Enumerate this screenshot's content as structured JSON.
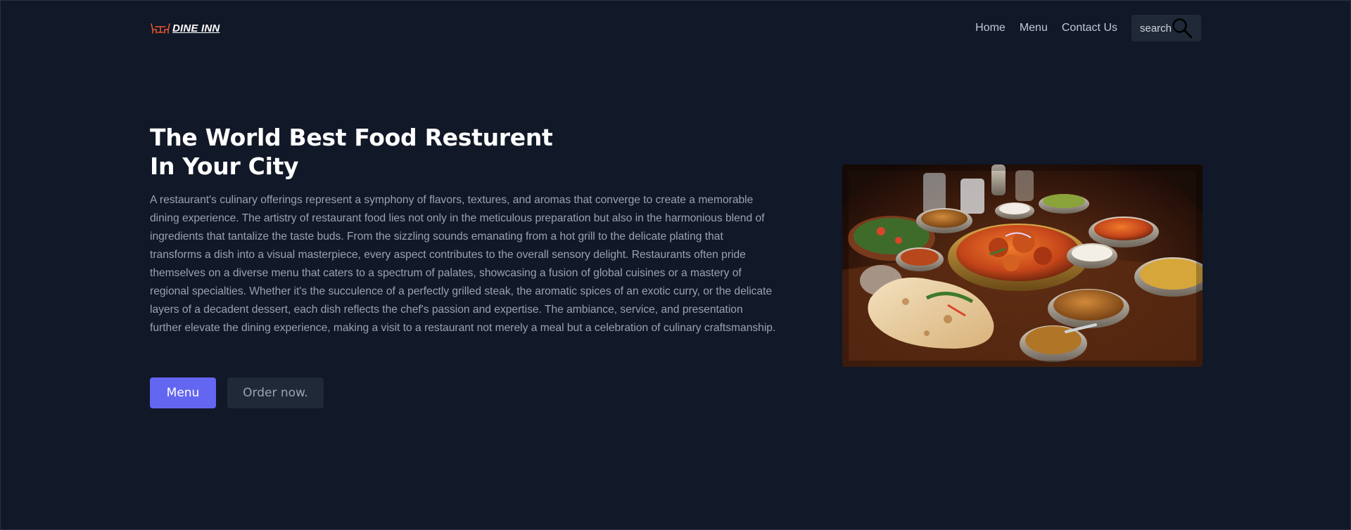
{
  "header": {
    "logo_text": "DINE INN",
    "nav": [
      {
        "label": "Home"
      },
      {
        "label": "Menu"
      },
      {
        "label": "Contact Us"
      }
    ],
    "search": {
      "placeholder": "search"
    }
  },
  "hero": {
    "title_line1": "The World Best Food Resturent",
    "title_line2": "In Your City",
    "description": "A restaurant's culinary offerings represent a symphony of flavors, textures, and aromas that converge to create a memorable dining experience. The artistry of restaurant food lies not only in the meticulous preparation but also in the harmonious blend of ingredients that tantalize the taste buds. From the sizzling sounds emanating from a hot grill to the delicate plating that transforms a dish into a visual masterpiece, every aspect contributes to the overall sensory delight. Restaurants often pride themselves on a diverse menu that caters to a spectrum of palates, showcasing a fusion of global cuisines or a mastery of regional specialties. Whether it's the succulence of a perfectly grilled steak, the aromatic spices of an exotic curry, or the delicate layers of a decadent dessert, each dish reflects the chef's passion and expertise. The ambiance, service, and presentation further elevate the dining experience, making a visit to a restaurant not merely a meal but a celebration of culinary craftsmanship.",
    "primary_button": "Menu",
    "secondary_button": "Order now."
  },
  "colors": {
    "background": "#111827",
    "accent": "#6366f1",
    "logo_icon": "#e4572e",
    "surface": "#1f2937"
  },
  "icons": {
    "logo": "dining-table-icon",
    "search": "magnifier-icon"
  }
}
